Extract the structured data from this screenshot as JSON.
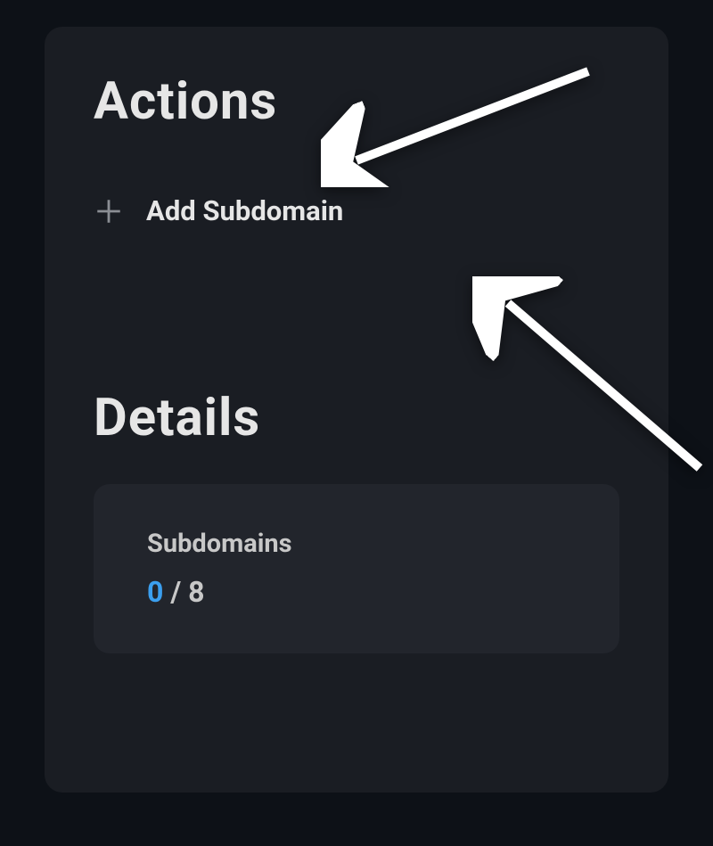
{
  "actions": {
    "title": "Actions",
    "addSubdomain": {
      "label": "Add Subdomain"
    }
  },
  "details": {
    "title": "Details",
    "subdomains": {
      "label": "Subdomains",
      "current": "0",
      "separator": " / ",
      "max": "8"
    }
  }
}
